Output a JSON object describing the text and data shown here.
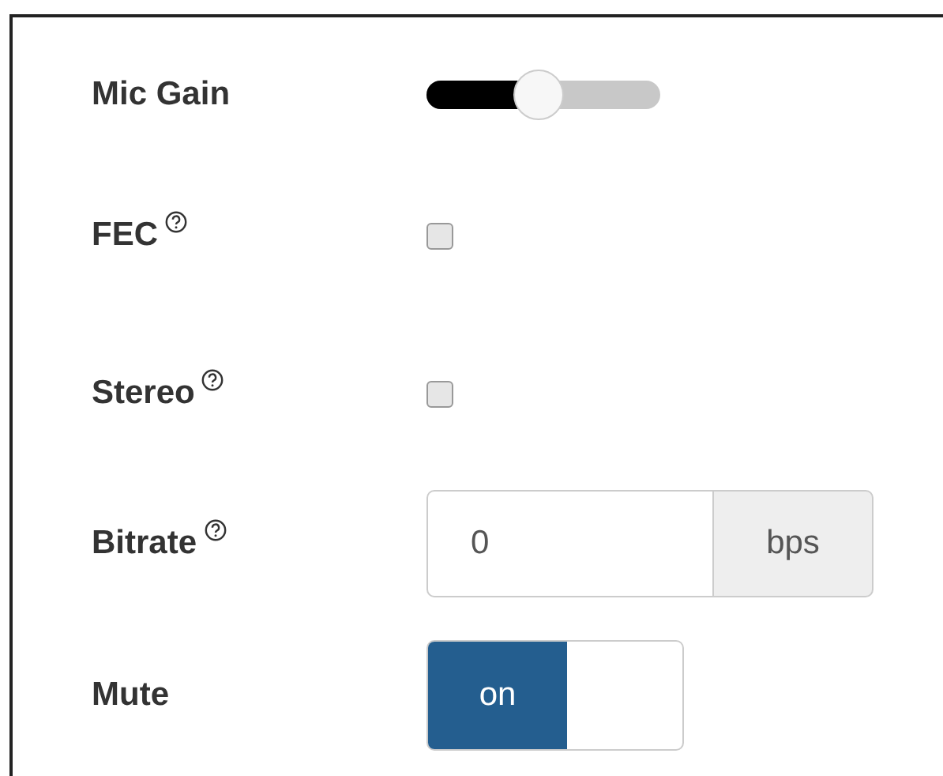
{
  "settings": [
    {
      "kind": "slider",
      "label": "Mic Gain",
      "help": false,
      "level": 0.48
    },
    {
      "kind": "checkbox",
      "label": "FEC",
      "help": true,
      "checked": false
    },
    {
      "kind": "checkbox",
      "label": "Stereo",
      "help": true,
      "checked": false
    },
    {
      "kind": "number",
      "label": "Bitrate",
      "help": true,
      "value": "0",
      "unit": "bps"
    },
    {
      "kind": "toggle",
      "label": "Mute",
      "help": false,
      "on": true,
      "on_label": "on"
    }
  ]
}
